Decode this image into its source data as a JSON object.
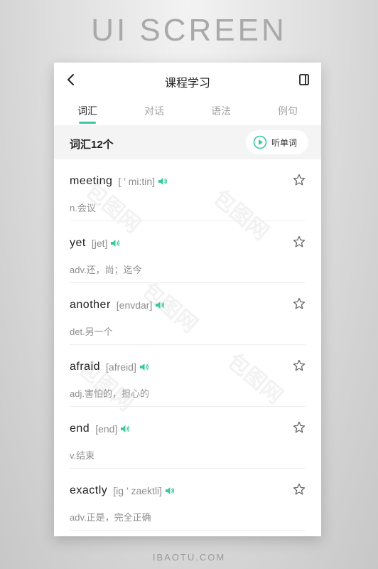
{
  "banner": "UI SCREEN",
  "footer": "IBAOTU.COM",
  "header": {
    "title": "课程学习"
  },
  "tabs": [
    {
      "label": "词汇",
      "active": true
    },
    {
      "label": "对话",
      "active": false
    },
    {
      "label": "语法",
      "active": false
    },
    {
      "label": "例句",
      "active": false
    }
  ],
  "vocab": {
    "count_label": "词汇12个",
    "listen_label": "听单词"
  },
  "words": [
    {
      "word": "meeting",
      "phonetic": "[ ′ mi:tin]",
      "meaning": "n.会议"
    },
    {
      "word": "yet",
      "phonetic": "[jet]",
      "meaning": "adv.还，尚；迄今"
    },
    {
      "word": "another",
      "phonetic": "[envdar]",
      "meaning": "det.另一个"
    },
    {
      "word": "afraid",
      "phonetic": "[afreid]",
      "meaning": "adj.害怕的，担心的"
    },
    {
      "word": "end",
      "phonetic": "[end]",
      "meaning": "v.结束"
    },
    {
      "word": "exactly",
      "phonetic": "[ig ′ zaektli]",
      "meaning": "adv.正是，完全正确"
    }
  ],
  "icons": {
    "back": "chevron-left-icon",
    "menu": "sidebar-panel-icon",
    "play": "play-circle-icon",
    "speaker": "speaker-icon",
    "star": "star-outline-icon"
  },
  "colors": {
    "accent": "#3cc89f"
  }
}
